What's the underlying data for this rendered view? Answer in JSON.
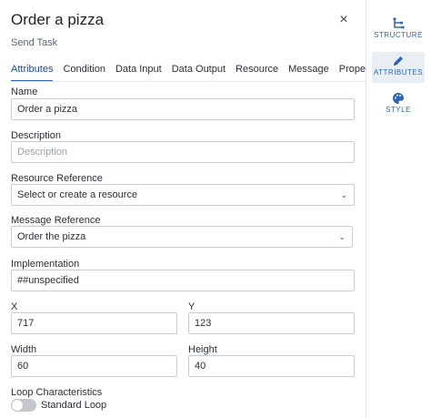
{
  "header": {
    "title": "Order a pizza",
    "subtitle": "Send Task",
    "close_glyph": "×"
  },
  "tabs": [
    {
      "label": "Attributes",
      "active": true
    },
    {
      "label": "Condition"
    },
    {
      "label": "Data Input"
    },
    {
      "label": "Data Output"
    },
    {
      "label": "Resource"
    },
    {
      "label": "Message"
    },
    {
      "label": "Property"
    }
  ],
  "form": {
    "name_label": "Name",
    "name_value": "Order a pizza",
    "description_label": "Description",
    "description_placeholder": "Description",
    "resource_label": "Resource Reference",
    "resource_placeholder": "Select or create a resource",
    "message_label": "Message Reference",
    "message_value": "Order the pizza",
    "implementation_label": "Implementation",
    "implementation_value": "##unspecified",
    "x_label": "X",
    "x_value": "717",
    "y_label": "Y",
    "y_value": "123",
    "width_label": "Width",
    "width_value": "60",
    "height_label": "Height",
    "height_value": "40",
    "loop_label": "Loop Characteristics",
    "loop_value": "Standard Loop",
    "chevron_glyph": "⌄"
  },
  "sidebar": {
    "items": [
      {
        "label": "STRUCTURE",
        "icon": "structure-icon"
      },
      {
        "label": "ATTRIBUTES",
        "icon": "pencil-icon",
        "active": true
      },
      {
        "label": "STYLE",
        "icon": "palette-icon"
      }
    ]
  },
  "colors": {
    "accent": "#2f66b3",
    "border": "#c9ced6",
    "active_bg": "#e9eef5"
  }
}
